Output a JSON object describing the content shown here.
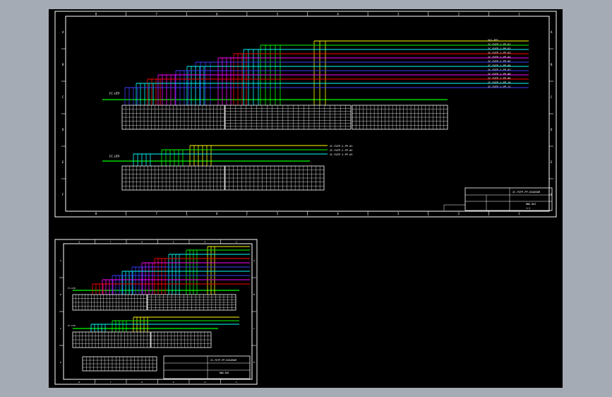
{
  "colors": {
    "background": "#000000",
    "viewport_frame": "#a5abb4",
    "sheet_border": "#ffffff",
    "green": "#00ff00",
    "yellow": "#ffff00",
    "cyan": "#00ffff",
    "red": "#ff0000",
    "magenta": "#ff00ff",
    "blue": "#3b3bff",
    "white": "#ffffff"
  },
  "sheet1": {
    "upper_bus_label": "FC-UTP",
    "lower_bus_label": "FC-UTP",
    "cable_labels": [
      "SG1-PP1",
      "2C-FUTP-1-PP-01",
      "2C-FUTP-1-PP-02",
      "2C-FUTP-1-PP-03",
      "2C-FUTP-1-PP-04",
      "2C-FUTP-1-PP-05",
      "2C-FUTP-1-PP-06",
      "2C-FUTP-1-PP-07",
      "2C-FUTP-1-PP-08",
      "2C-FUTP-1-PP-09",
      "2C-FUTP-1-PP-10",
      "2C-FUTP-1-PP-11"
    ],
    "lower_cable_labels": [
      "2C-FUTP-2-PP-01",
      "2C-FUTP-2-PP-02",
      "2C-FUTP-2-PP-03"
    ],
    "column_markers": [
      "8",
      "7",
      "6",
      "5",
      "4",
      "3",
      "2",
      "1"
    ],
    "row_markers": [
      "A",
      "B",
      "C",
      "D",
      "E",
      "F"
    ],
    "title_block": {
      "drawing_title": "2C-FUTP-PP-DIAGRAM",
      "drawing_number": "DWG-001",
      "scale": "1:1"
    }
  },
  "sheet2": {
    "upper_bus_label": "FC-UTP",
    "lower_bus_label": "FC-UTP",
    "title_block": {
      "drawing_title": "2C-FUTP-PP-DIAGRAM",
      "drawing_number": "DWG-002"
    }
  }
}
